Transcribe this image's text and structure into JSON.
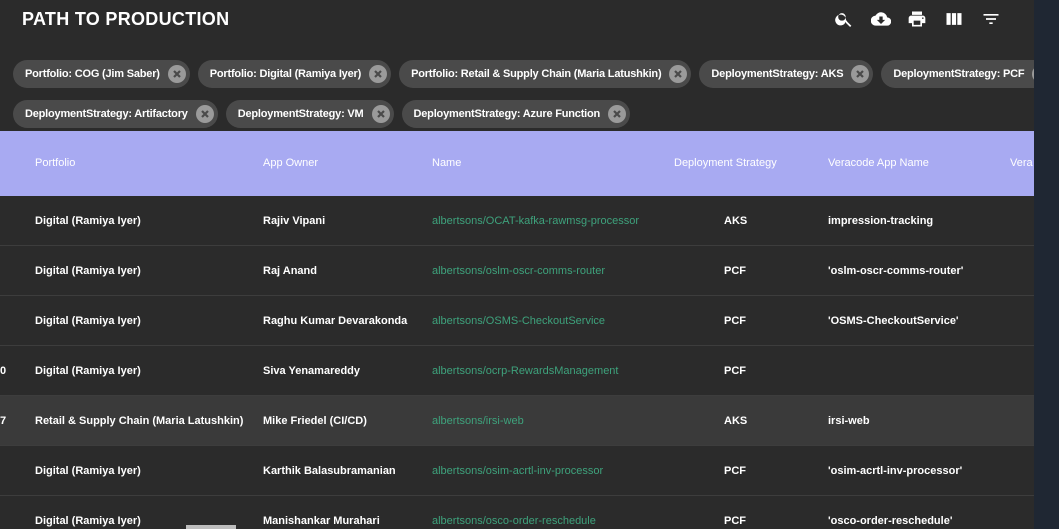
{
  "app": {
    "title": "PATH TO PRODUCTION"
  },
  "toolbar": {
    "icons": [
      "search-icon",
      "cloud-download-icon",
      "print-icon",
      "view-column-icon",
      "filter-list-icon"
    ]
  },
  "filters": {
    "row1": [
      "Portfolio: COG (Jim Saber)",
      "Portfolio: Digital (Ramiya Iyer)",
      "Portfolio: Retail & Supply Chain (Maria Latushkin)",
      "DeploymentStrategy: AKS",
      "DeploymentStrategy: PCF"
    ],
    "row2": [
      "DeploymentStrategy: Artifactory",
      "DeploymentStrategy: VM",
      "DeploymentStrategy: Azure Function"
    ]
  },
  "table": {
    "columns": {
      "portfolio": "Portfolio",
      "app_owner": "App Owner",
      "name": "Name",
      "deployment_strategy": "Deployment Strategy",
      "veracode_app_name": "Veracode App Name",
      "veracode_partial": "Vera"
    },
    "rows": [
      {
        "edge": "",
        "portfolio": "Digital (Ramiya Iyer)",
        "app_owner": "Rajiv Vipani",
        "name": "albertsons/OCAT-kafka-rawmsg-processor",
        "strategy": "AKS",
        "veracode": "impression-tracking"
      },
      {
        "edge": "",
        "portfolio": "Digital (Ramiya Iyer)",
        "app_owner": "Raj Anand",
        "name": "albertsons/oslm-oscr-comms-router",
        "strategy": "PCF",
        "veracode": "'oslm-oscr-comms-router'"
      },
      {
        "edge": "",
        "portfolio": "Digital (Ramiya Iyer)",
        "app_owner": "Raghu Kumar Devarakonda",
        "name": "albertsons/OSMS-CheckoutService",
        "strategy": "PCF",
        "veracode": "'OSMS-CheckoutService'"
      },
      {
        "edge": "0",
        "portfolio": "Digital (Ramiya Iyer)",
        "app_owner": "Siva Yenamareddy",
        "name": "albertsons/ocrp-RewardsManagement",
        "strategy": "PCF",
        "veracode": ""
      },
      {
        "edge": "7",
        "portfolio": "Retail & Supply Chain (Maria Latushkin)",
        "app_owner": "Mike Friedel (CI/CD)",
        "name": "albertsons/irsi-web",
        "strategy": "AKS",
        "veracode": "irsi-web"
      },
      {
        "edge": "",
        "portfolio": "Digital (Ramiya Iyer)",
        "app_owner": "Karthik Balasubramanian",
        "name": "albertsons/osim-acrtl-inv-processor",
        "strategy": "PCF",
        "veracode": "'osim-acrtl-inv-processor'"
      },
      {
        "edge": "",
        "portfolio": "Digital (Ramiya Iyer)",
        "app_owner": "Manishankar Murahari",
        "name": "albertsons/osco-order-reschedule",
        "strategy": "PCF",
        "veracode": "'osco-order-reschedule'"
      }
    ]
  }
}
